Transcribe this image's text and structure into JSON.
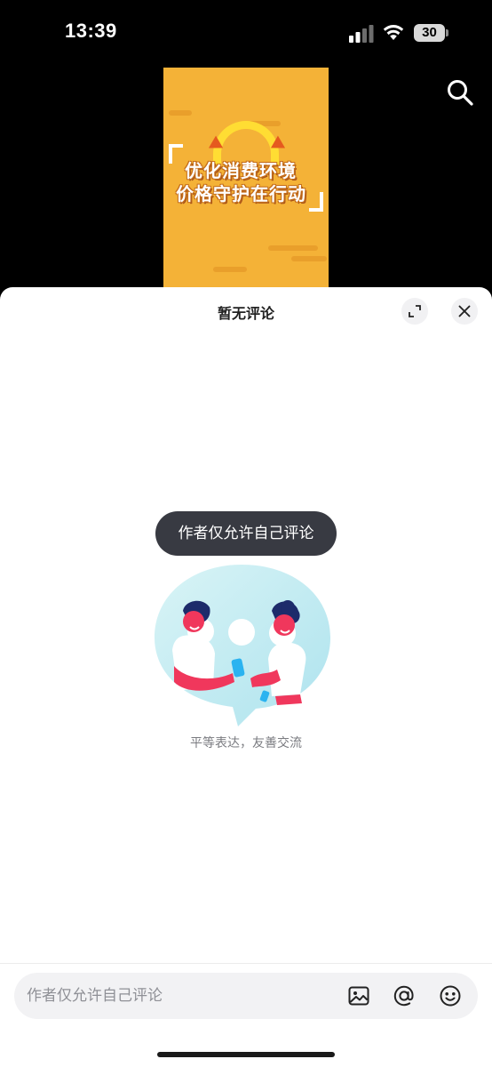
{
  "status_bar": {
    "time": "13:39",
    "battery": "30"
  },
  "video": {
    "line1": "优化消费环境",
    "line2": "价格守护在行动"
  },
  "comments": {
    "title": "暂无评论",
    "toast": "作者仅允许自己评论",
    "empty_slogan": "平等表达，友善交流",
    "input_placeholder": "作者仅允许自己评论"
  },
  "icons": {
    "search": "search-icon",
    "expand": "expand-icon",
    "close": "close-icon",
    "image": "image-icon",
    "at": "at-icon",
    "emoji": "emoji-icon"
  },
  "colors": {
    "video_bg": "#f4b237",
    "toast_bg": "#383a42",
    "illustration_bubble": "#c8eef4",
    "figure_red": "#f0375c"
  }
}
